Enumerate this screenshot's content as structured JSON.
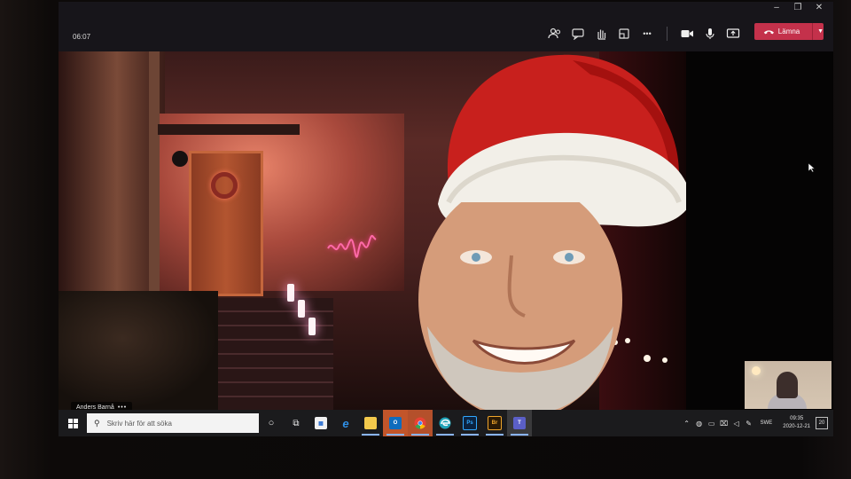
{
  "window": {
    "controls": {
      "minimize": "–",
      "restore": "❐",
      "close": "✕"
    }
  },
  "call": {
    "duration": "06:07",
    "tools": [
      {
        "name": "participants-icon"
      },
      {
        "name": "chat-icon"
      },
      {
        "name": "raise-hand-icon"
      },
      {
        "name": "breakout-rooms-icon"
      },
      {
        "name": "more-actions-icon",
        "label": "•••"
      },
      {
        "name": "camera-icon"
      },
      {
        "name": "microphone-icon"
      },
      {
        "name": "share-screen-icon"
      }
    ],
    "leave_label": "Lämna",
    "leave_color": "#c4314b"
  },
  "participant": {
    "name": "Anders Barnå",
    "more": "•••"
  },
  "taskbar": {
    "search_placeholder": "Skriv här för att söka",
    "apps": [
      {
        "name": "cortana-icon",
        "glyph": "○"
      },
      {
        "name": "task-view-icon",
        "glyph": "⧉"
      },
      {
        "name": "store-icon",
        "glyph": "🛍"
      },
      {
        "name": "internet-explorer-icon",
        "glyph": "e"
      },
      {
        "name": "file-explorer-icon",
        "glyph": "▬"
      },
      {
        "name": "outlook-icon",
        "glyph": "O"
      },
      {
        "name": "chrome-icon",
        "glyph": "●"
      },
      {
        "name": "edge-icon",
        "glyph": "e"
      },
      {
        "name": "photoshop-icon",
        "glyph": "Ps"
      },
      {
        "name": "bridge-icon",
        "glyph": "Br"
      },
      {
        "name": "teams-icon",
        "glyph": "T"
      }
    ],
    "tray": {
      "language": "SWE",
      "time": "09:35",
      "date": "2020-12-21",
      "notifications": "20"
    }
  }
}
